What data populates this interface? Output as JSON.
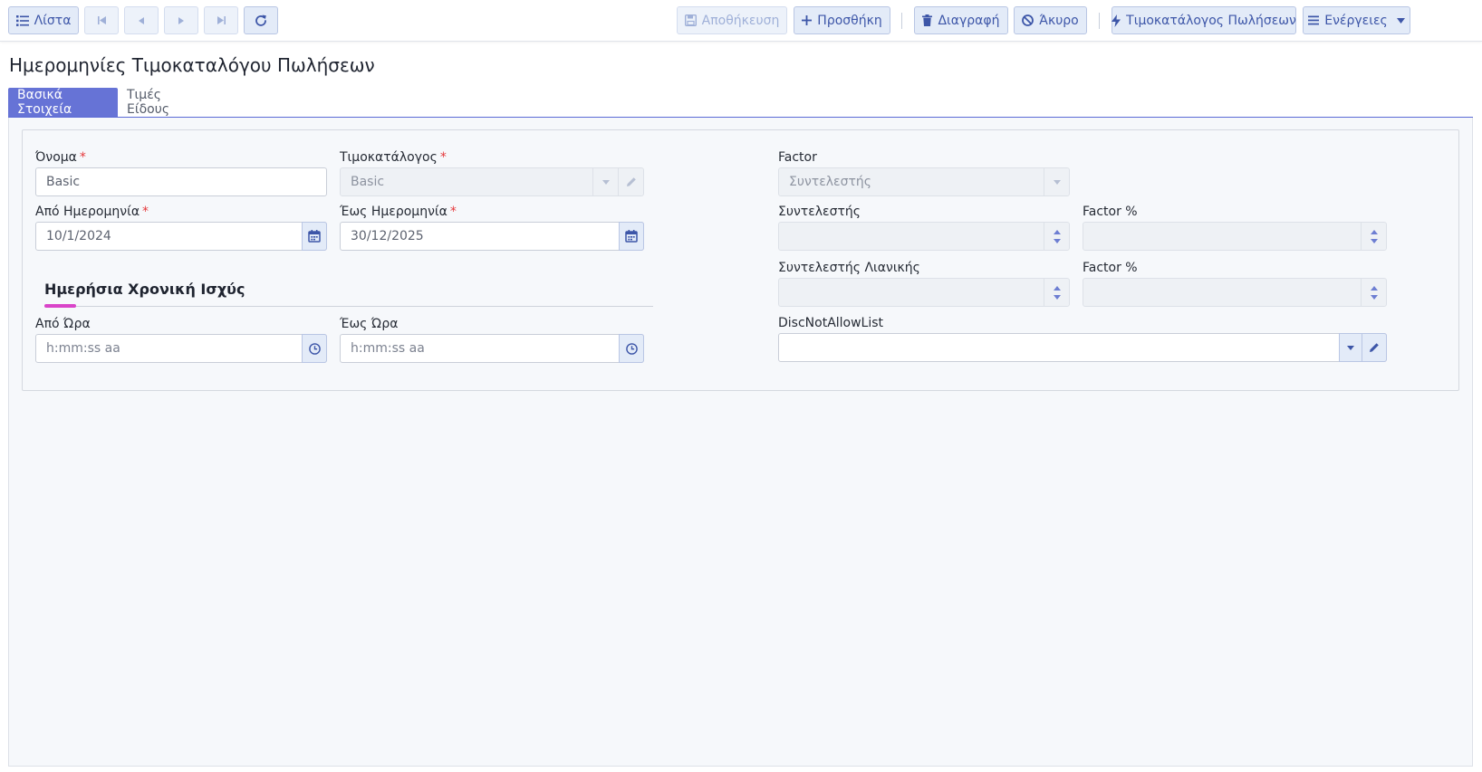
{
  "toolbar": {
    "list_label": "Λίστα",
    "save_label": "Αποθήκευση",
    "add_label": "Προσθήκη",
    "delete_label": "Διαγραφή",
    "cancel_label": "Άκυρο",
    "pricelist_label": "Τιμοκατάλογος Πωλήσεων",
    "actions_label": "Ενέργειες"
  },
  "page": {
    "title": "Ημερομηνίες Τιμοκαταλόγου Πωλήσεων"
  },
  "tabs": [
    {
      "label": "Βασικά Στοιχεία",
      "active": true
    },
    {
      "label": "Τιμές Είδους",
      "active": false
    }
  ],
  "form": {
    "name": {
      "label": "Όνομα",
      "required_mark": "*",
      "value": "Basic"
    },
    "pricelist": {
      "label": "Τιμοκατάλογος",
      "required_mark": "*",
      "value": "Basic"
    },
    "from_date": {
      "label": "Από Ημερομηνία",
      "required_mark": "*",
      "value": "10/1/2024"
    },
    "to_date": {
      "label": "Έως Ημερομηνία",
      "required_mark": "*",
      "value": "30/12/2025"
    },
    "section_title": "Ημερήσια Χρονική Ισχύς",
    "from_time": {
      "label": "Από Ώρα",
      "placeholder": "h:mm:ss aa"
    },
    "to_time": {
      "label": "Έως Ώρα",
      "placeholder": "h:mm:ss aa"
    },
    "factor": {
      "label": "Factor",
      "value": "Συντελεστής"
    },
    "coefficient": {
      "label": "Συντελεστής",
      "value": ""
    },
    "factor_percent_1": {
      "label": "Factor %",
      "value": ""
    },
    "retail_coefficient": {
      "label": "Συντελεστής Λιανικής",
      "value": ""
    },
    "factor_percent_2": {
      "label": "Factor %",
      "value": ""
    },
    "disc_not_allow_list": {
      "label": "DiscNotAllowList",
      "value": ""
    }
  },
  "colors": {
    "accent": "#6673d6",
    "button_bg": "#e3ebf8",
    "button_text": "#3d56a8",
    "required": "#e5393c",
    "section_accent": "#d944c9"
  }
}
